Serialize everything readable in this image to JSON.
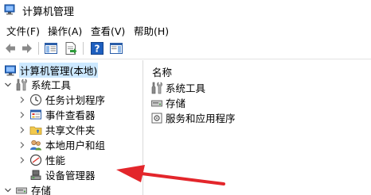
{
  "window": {
    "title": "计算机管理",
    "icon": "computer-management-icon"
  },
  "menu": {
    "items": [
      "文件(F)",
      "操作(A)",
      "查看(V)",
      "帮助(H)"
    ]
  },
  "toolbar": {
    "buttons": [
      "back-arrow-icon",
      "forward-arrow-icon",
      "show-hide-tree-icon",
      "export-list-icon",
      "help-icon",
      "show-hide-action-pane-icon"
    ]
  },
  "tree": {
    "root_label": "计算机管理(本地)",
    "system_tools_label": "系统工具",
    "task_scheduler_label": "任务计划程序",
    "event_viewer_label": "事件查看器",
    "shared_folders_label": "共享文件夹",
    "local_users_label": "本地用户和组",
    "performance_label": "性能",
    "device_manager_label": "设备管理器",
    "storage_label": "存储"
  },
  "list": {
    "column_name": "名称",
    "items": [
      "系统工具",
      "存储",
      "服务和应用程序"
    ]
  },
  "colors": {
    "annotation_arrow": "#e3262b",
    "selection": "#cce8ff"
  }
}
